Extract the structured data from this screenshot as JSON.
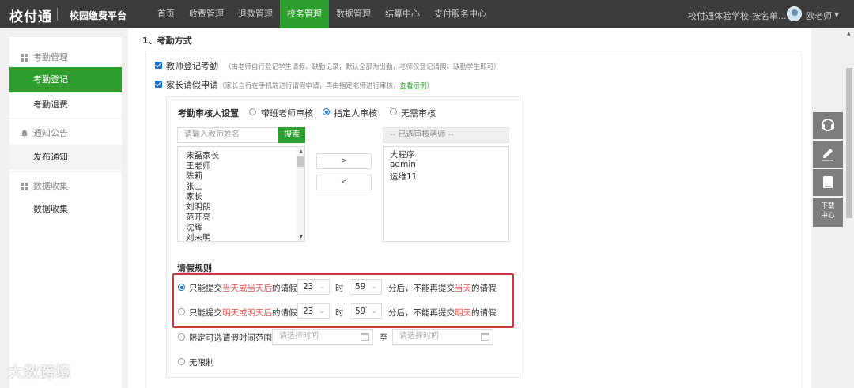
{
  "app": {
    "logo": "校付通",
    "platform": "校园缴费平台",
    "school": "校付通体验学校-按名单...",
    "user": "欧老师"
  },
  "nav": [
    "首页",
    "收费管理",
    "退款管理",
    "校务管理",
    "数据管理",
    "结算中心",
    "支付服务中心"
  ],
  "sidebar": {
    "groups": [
      {
        "label": "考勤管理",
        "items": [
          "考勤登记",
          "考勤退费"
        ]
      },
      {
        "label": "通知公告",
        "items": [
          "发布通知"
        ]
      },
      {
        "label": "数据收集",
        "items": [
          "数据收集"
        ]
      }
    ]
  },
  "main": {
    "section_title": "1、考勤方式",
    "teacher_reg": {
      "label": "教师登记考勤",
      "desc": "（由老师自行登记学生请假、缺勤记录，默认全部为出勤，老师仅登记请假、缺勤学生即可）"
    },
    "parent_req": {
      "label": "家长请假申请",
      "desc": "（家长自行在手机端进行请假申请，再由指定老师进行审核，",
      "link": "查看示例",
      "desc_end": "）"
    },
    "reviewer": {
      "title": "考勤审核人设置",
      "options": [
        "带班老师审核",
        "指定人审核",
        "无需审核"
      ],
      "search_placeholder": "请输入教师姓名",
      "search_button": "搜索",
      "candidates": [
        "宋磊家长",
        "王老师",
        "陈莉",
        "张三",
        "家长",
        "刘明朗",
        "范开亮",
        "沈辉",
        "刘未明"
      ],
      "move_right": ">",
      "move_left": "<",
      "selected_header": "-- 已选审核老师 --",
      "selected": [
        "大程序",
        "admin",
        "运维11"
      ]
    },
    "rules": {
      "title": "请假规则",
      "rule1": {
        "a": "只能提交",
        "b": "当天或当天后",
        "c": "的请假,",
        "hour": "23",
        "t1": "时",
        "min": "59",
        "t2": "分后，不能再提交",
        "d": "当天",
        "e": "的请假"
      },
      "rule2": {
        "a": "只能提交",
        "b": "明天或明天后",
        "c": "的请假,",
        "hour": "23",
        "t1": "时",
        "min": "59",
        "t2": "分后，不能再提交",
        "d": "明天",
        "e": "的请假"
      },
      "rule3": {
        "label": "限定可选请假时间范围",
        "start_placeholder": "请选择时间",
        "to": "至",
        "end_placeholder": "请选择时间"
      },
      "rule4": {
        "label": "无限制"
      }
    }
  },
  "float": {
    "download": "下载",
    "center": "中心"
  },
  "watermark": "大数跨境"
}
